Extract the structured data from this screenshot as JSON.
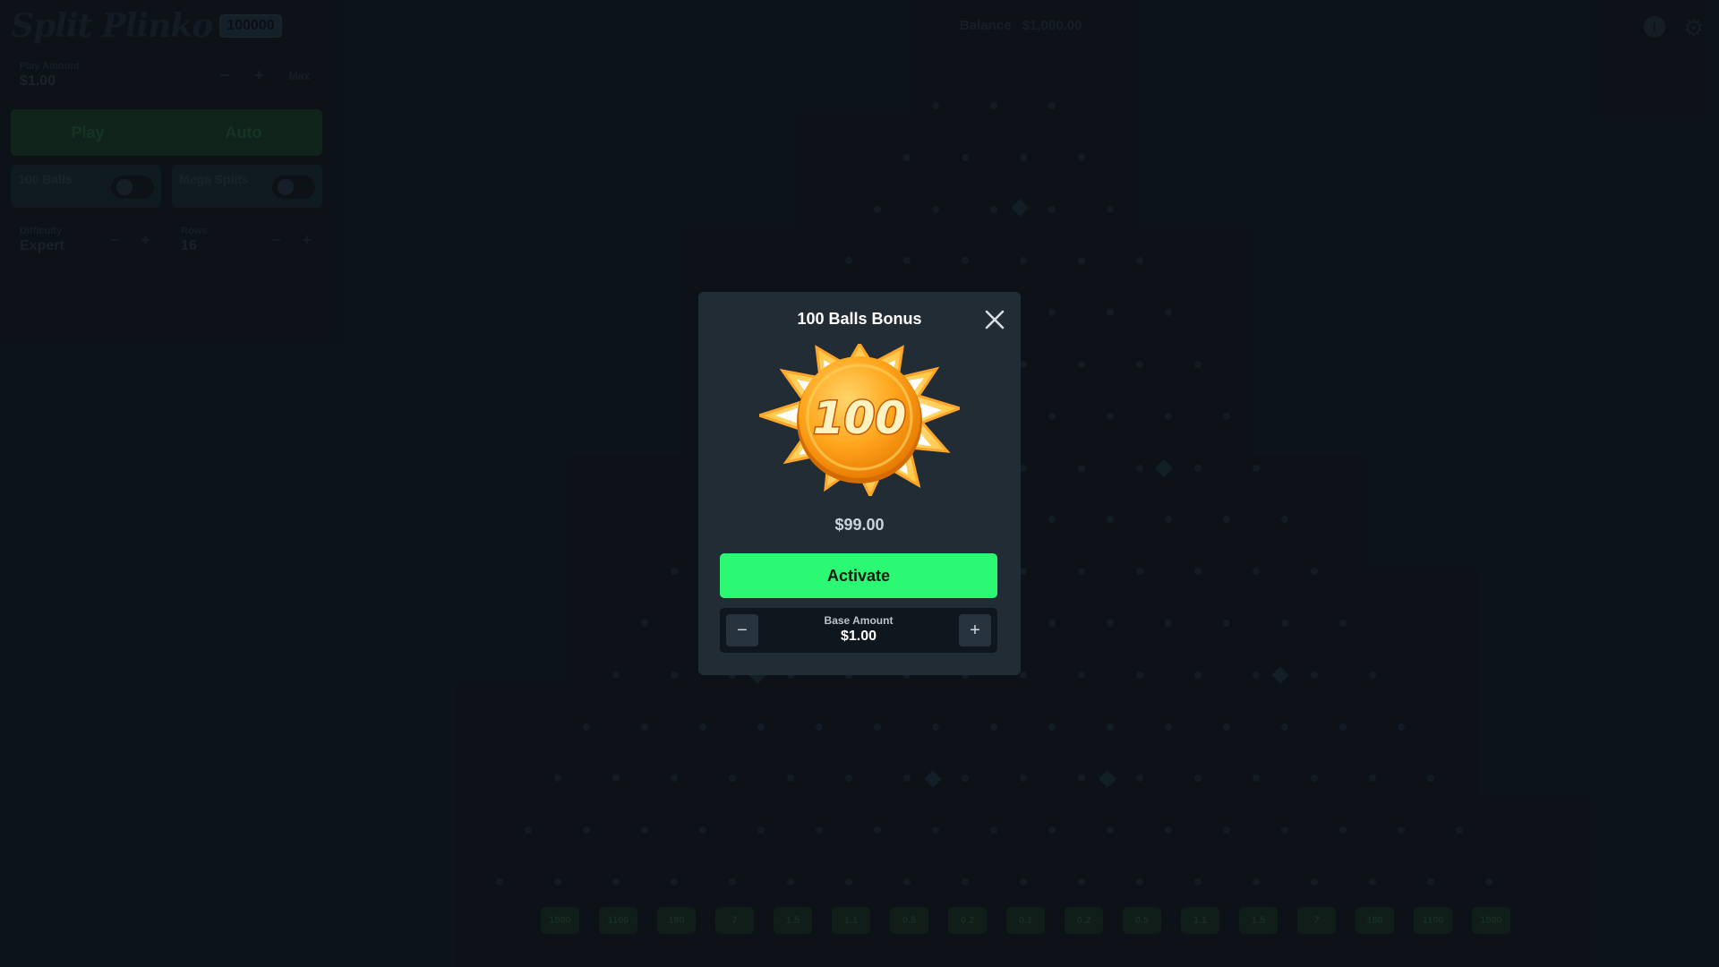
{
  "header": {
    "logo_text": "Split Plinko",
    "logo_badge": "100000",
    "balance_label": "Balance",
    "balance_value": "$1,000.00"
  },
  "panel": {
    "play_amount_label": "Play Amount",
    "play_amount_value": "$1.00",
    "max_label": "Max",
    "play_tab": "Play",
    "auto_tab": "Auto",
    "toggle_100_balls": "100 Balls",
    "toggle_mega_splits": "Mega Splits",
    "difficulty_label": "Difficulty",
    "difficulty_value": "Expert",
    "rows_label": "Rows",
    "rows_value": "16"
  },
  "board": {
    "buckets": [
      "1000",
      "1100",
      "180",
      "7",
      "1.5",
      "1.1",
      "0.5",
      "0.2",
      "0.1",
      "0.2",
      "0.5",
      "1.1",
      "1.5",
      "7",
      "180",
      "1100",
      "1000"
    ]
  },
  "modal": {
    "title": "100 Balls Bonus",
    "coin_text": "100",
    "price": "$99.00",
    "activate_label": "Activate",
    "base_amount_label": "Base Amount",
    "base_amount_value": "$1.00"
  },
  "colors": {
    "background": "#0f171e",
    "modal": "#222c35",
    "accent_green": "#2bf873"
  }
}
